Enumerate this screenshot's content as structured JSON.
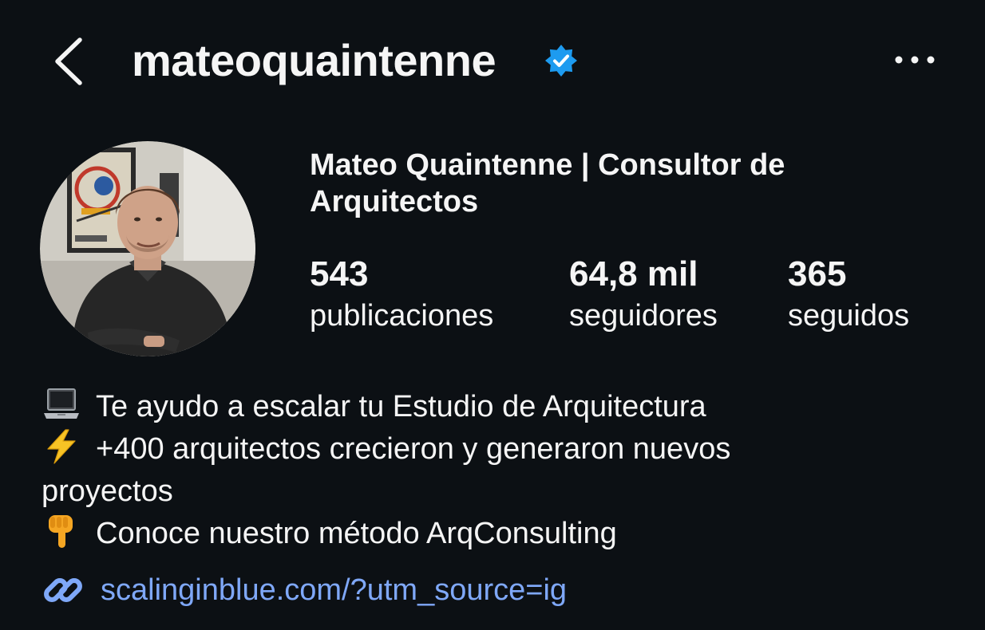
{
  "header": {
    "username": "mateoquaintenne",
    "verified": true,
    "back_icon": "chevron-left-icon",
    "more_icon": "more-horizontal-icon",
    "verified_icon": "verified-badge-icon"
  },
  "profile": {
    "display_name": "Mateo Quaintenne | Consultor de Arquitectos",
    "avatar_icon": "profile-photo"
  },
  "stats": {
    "posts": {
      "value": "543",
      "label": "publicaciones"
    },
    "followers": {
      "value": "64,8 mil",
      "label": "seguidores"
    },
    "following": {
      "value": "365",
      "label": "seguidos"
    }
  },
  "bio": {
    "line1": "Te ayudo a escalar tu Estudio de Arquitectura",
    "line1_icon": "laptop-icon",
    "line2": "+400 arquitectos crecieron y generaron nuevos proyectos",
    "line2_icon": "lightning-icon",
    "line3": "Conoce nuestro método ArqConsulting",
    "line3_icon": "pointing-down-icon"
  },
  "link": {
    "url": "scalinginblue.com/?utm_source=ig",
    "icon": "link-icon"
  },
  "colors": {
    "background": "#0c1014",
    "text": "#f5f5f5",
    "link": "#7fa8f8",
    "verified": "#1d9bf0"
  }
}
